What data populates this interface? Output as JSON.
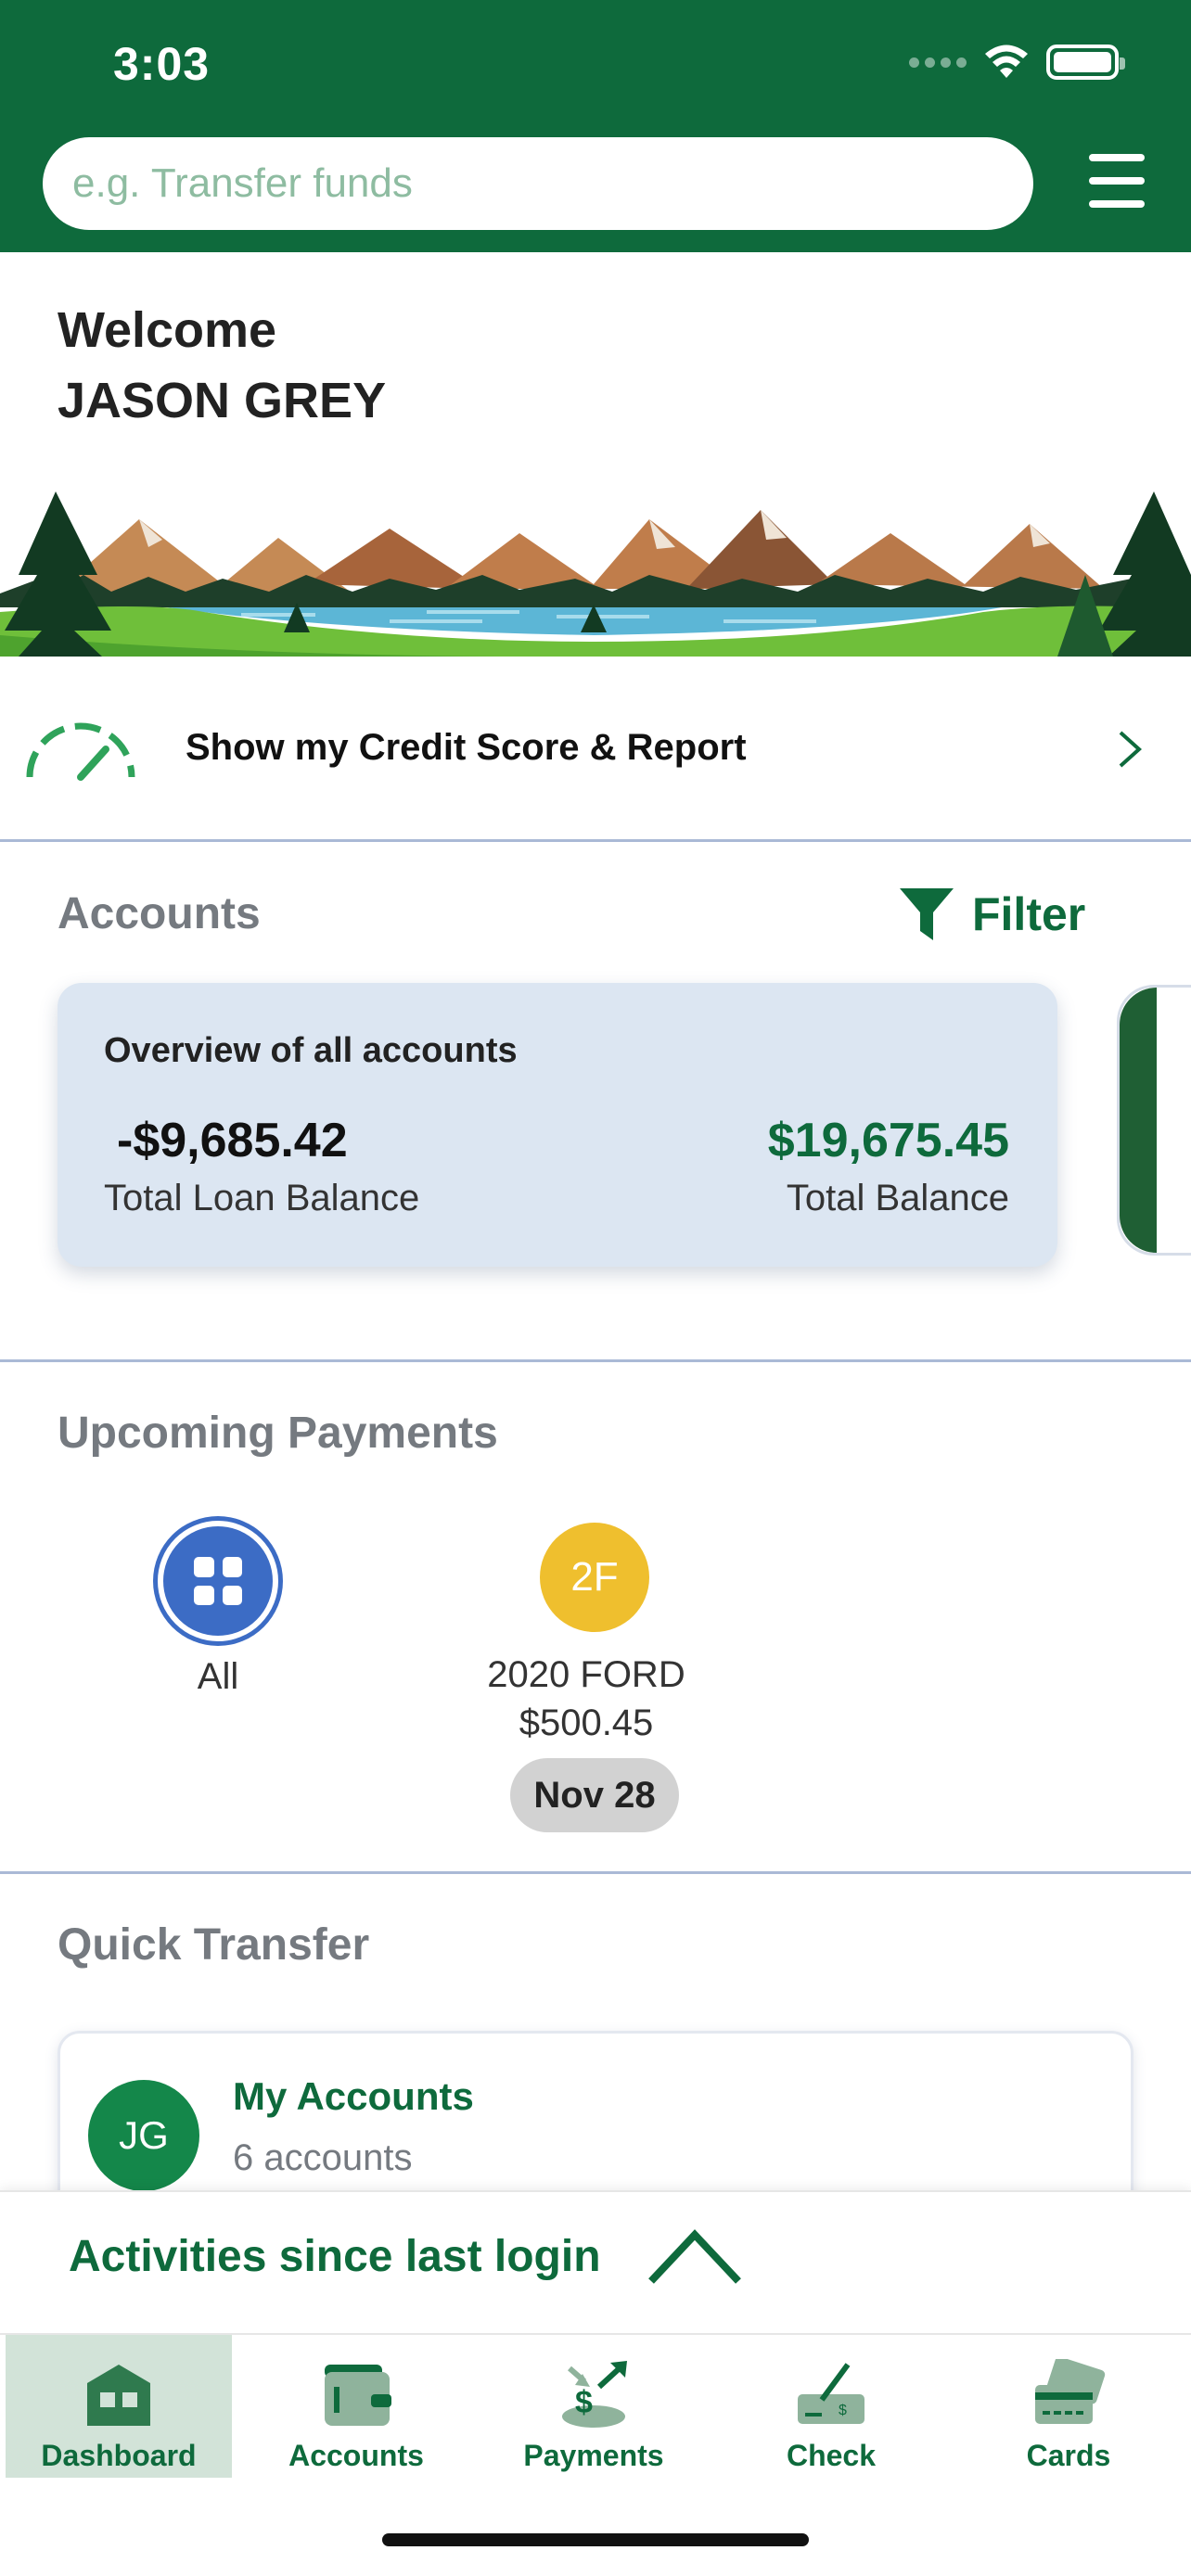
{
  "status_bar": {
    "time": "3:03"
  },
  "header": {
    "search_placeholder": "e.g. Transfer funds"
  },
  "welcome": {
    "greeting": "Welcome",
    "name": "JASON GREY"
  },
  "credit": {
    "label": "Show my Credit Score & Report"
  },
  "accounts": {
    "title": "Accounts",
    "filter_label": "Filter",
    "overview": {
      "title": "Overview of all accounts",
      "loan_balance": "-$9,685.42",
      "loan_label": "Total Loan Balance",
      "total_balance": "$19,675.45",
      "total_label": "Total Balance"
    }
  },
  "upcoming": {
    "title": "Upcoming Payments",
    "all_label": "All",
    "items": [
      {
        "initials": "2F",
        "name": "2020 FORD",
        "amount": "$500.45",
        "date": "Nov 28"
      }
    ]
  },
  "quick_transfer": {
    "title": "Quick Transfer",
    "card": {
      "initials": "JG",
      "title": "My Accounts",
      "subtitle": "6 accounts"
    }
  },
  "activities": {
    "label": "Activities since last login"
  },
  "tabs": [
    {
      "label": "Dashboard",
      "icon": "dashboard-icon",
      "active": true
    },
    {
      "label": "Accounts",
      "icon": "wallet-icon",
      "active": false
    },
    {
      "label": "Payments",
      "icon": "payments-icon",
      "active": false
    },
    {
      "label": "Check",
      "icon": "check-deposit-icon",
      "active": false
    },
    {
      "label": "Cards",
      "icon": "cards-icon",
      "active": false
    }
  ],
  "colors": {
    "brand_green": "#0e6a3c",
    "card_blue": "#dce6f2",
    "payment_all_blue": "#3c6cc5",
    "payment_ford_yellow": "#efbf2e",
    "active_tab_bg": "#d2e3d8",
    "muted_text": "#757a80"
  }
}
